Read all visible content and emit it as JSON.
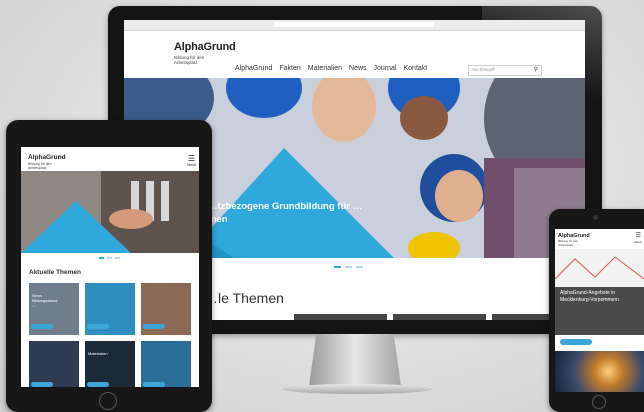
{
  "brand": {
    "name": "AlphaGrund",
    "tagline": "Bildung für den Arbeitsplatz"
  },
  "desktop": {
    "nav": [
      "AlphaGrund",
      "Fakten",
      "Materialien",
      "News",
      "Journal",
      "Kontakt"
    ],
    "search_placeholder": "Suchbegriff",
    "hero_text": "…tzbezogene Grundbildung für …men",
    "section_title": "…le Themen"
  },
  "tablet": {
    "menu_label": "Menü",
    "section_title": "Aktuelle Themen",
    "cards": [
      {
        "label": "News Bildungsstand: ...",
        "bg": "#6f7d8c"
      },
      {
        "label": "",
        "bg": "#2e8ec0"
      },
      {
        "label": "",
        "bg": "#8a6a55"
      },
      {
        "label": "",
        "bg": "#2f3b52"
      },
      {
        "label": "Materialien",
        "bg": "#1c2a3a"
      },
      {
        "label": "",
        "bg": "#2a6f9a"
      }
    ]
  },
  "phone": {
    "menu_label": "Menü",
    "banner_text": "AlphaGrund-Angebote in Mecklenburg-Vorpommern"
  },
  "colors": {
    "accent": "#3da6d9",
    "hero_triangle": "#2fa8dc"
  }
}
